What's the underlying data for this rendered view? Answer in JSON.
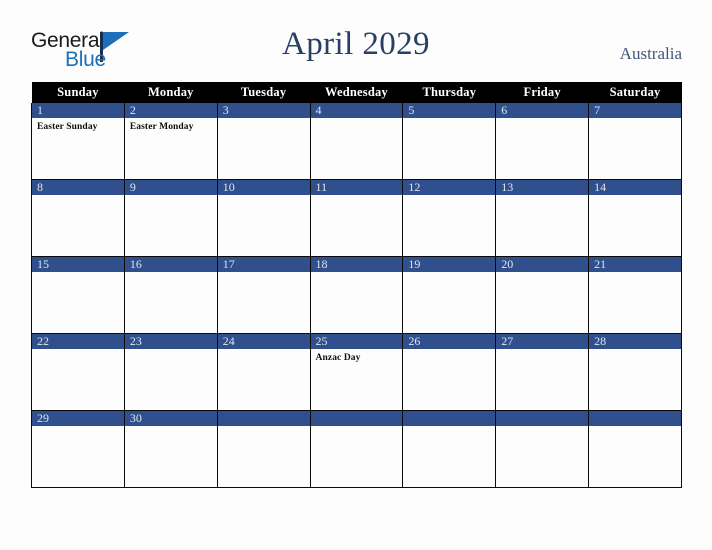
{
  "brand": {
    "name_part1": "General",
    "name_part2": "Blue",
    "triangle_color": "#1c6fba",
    "text_color": "#1b1b1b"
  },
  "header": {
    "title": "April 2029",
    "country": "Australia",
    "title_color": "#2a3f66",
    "country_color": "#42567c"
  },
  "calendar": {
    "weekday_headers": [
      "Sunday",
      "Monday",
      "Tuesday",
      "Wednesday",
      "Thursday",
      "Friday",
      "Saturday"
    ],
    "header_bg": "#000000",
    "header_text": "#ffffff",
    "daynum_bg": "#2f508d",
    "daynum_text": "#dfe4ee",
    "grid_line": "#0a0a0a",
    "cell_bg": "#fdfdfd",
    "weeks": [
      [
        {
          "day": "1",
          "events": [
            "Easter Sunday"
          ]
        },
        {
          "day": "2",
          "events": [
            "Easter Monday"
          ]
        },
        {
          "day": "3",
          "events": []
        },
        {
          "day": "4",
          "events": []
        },
        {
          "day": "5",
          "events": []
        },
        {
          "day": "6",
          "events": []
        },
        {
          "day": "7",
          "events": []
        }
      ],
      [
        {
          "day": "8",
          "events": []
        },
        {
          "day": "9",
          "events": []
        },
        {
          "day": "10",
          "events": []
        },
        {
          "day": "11",
          "events": []
        },
        {
          "day": "12",
          "events": []
        },
        {
          "day": "13",
          "events": []
        },
        {
          "day": "14",
          "events": []
        }
      ],
      [
        {
          "day": "15",
          "events": []
        },
        {
          "day": "16",
          "events": []
        },
        {
          "day": "17",
          "events": []
        },
        {
          "day": "18",
          "events": []
        },
        {
          "day": "19",
          "events": []
        },
        {
          "day": "20",
          "events": []
        },
        {
          "day": "21",
          "events": []
        }
      ],
      [
        {
          "day": "22",
          "events": []
        },
        {
          "day": "23",
          "events": []
        },
        {
          "day": "24",
          "events": []
        },
        {
          "day": "25",
          "events": [
            "Anzac Day"
          ]
        },
        {
          "day": "26",
          "events": []
        },
        {
          "day": "27",
          "events": []
        },
        {
          "day": "28",
          "events": []
        }
      ],
      [
        {
          "day": "29",
          "events": []
        },
        {
          "day": "30",
          "events": []
        },
        {
          "day": "",
          "events": []
        },
        {
          "day": "",
          "events": []
        },
        {
          "day": "",
          "events": []
        },
        {
          "day": "",
          "events": []
        },
        {
          "day": "",
          "events": []
        }
      ]
    ]
  }
}
